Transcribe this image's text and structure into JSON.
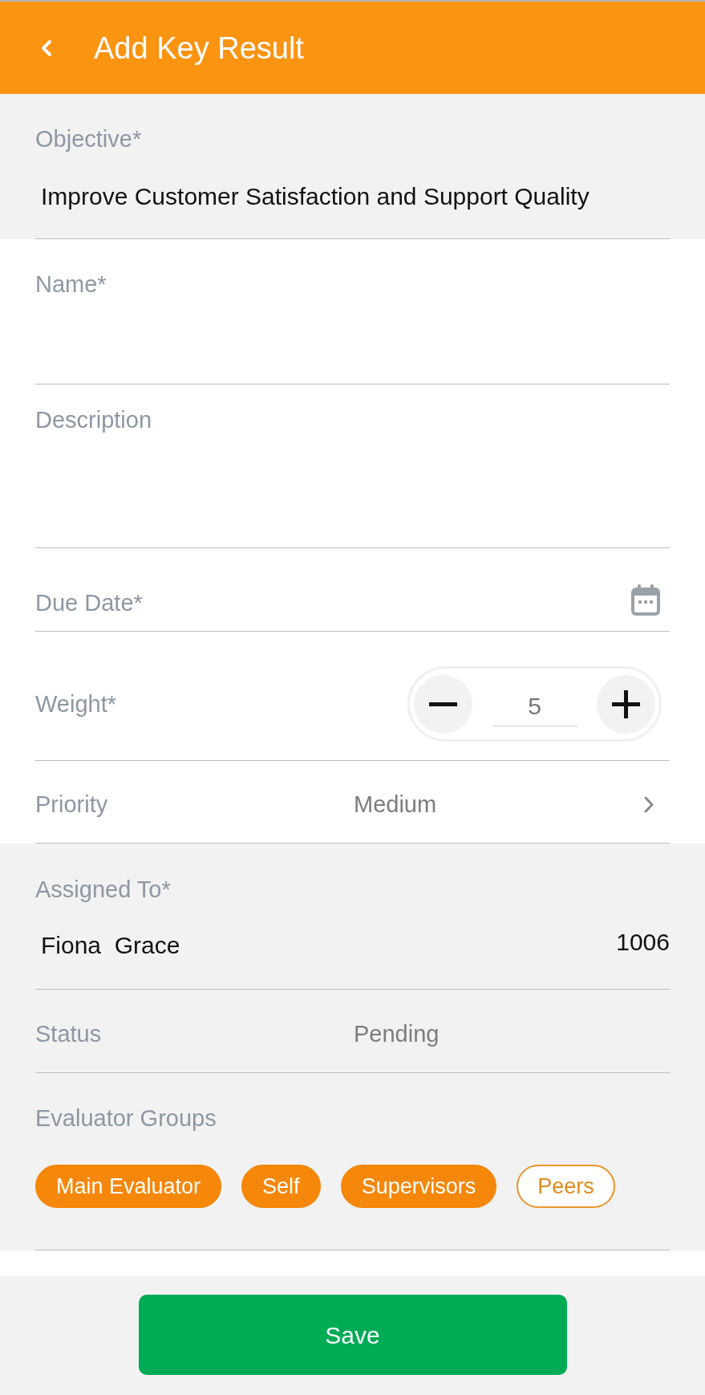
{
  "header": {
    "title": "Add Key Result"
  },
  "form": {
    "fields": [
      {
        "kind": "readonly",
        "label": "Objective*",
        "value": "Improve Customer Satisfaction and Support Quality"
      },
      {
        "kind": "text",
        "label": "Name*"
      },
      {
        "kind": "textarea",
        "label": "Description"
      },
      {
        "kind": "date",
        "label": "Due Date*"
      },
      {
        "kind": "stepper",
        "label": "Weight*",
        "value": "5"
      },
      {
        "kind": "picker",
        "label": "Priority",
        "value": "Medium"
      },
      {
        "kind": "assignee",
        "label": "Assigned To*",
        "value": "Fiona  Grace",
        "id": "1006"
      },
      {
        "kind": "info",
        "label": "Status",
        "value": "Pending"
      },
      {
        "kind": "chips",
        "label": "Evaluator Groups",
        "options": [
          {
            "label": "Main Evaluator",
            "selected": true
          },
          {
            "label": "Self",
            "selected": true
          },
          {
            "label": "Supervisors",
            "selected": true
          },
          {
            "label": "Peers",
            "selected": false
          }
        ]
      }
    ]
  },
  "save_button": {
    "label": "Save"
  }
}
